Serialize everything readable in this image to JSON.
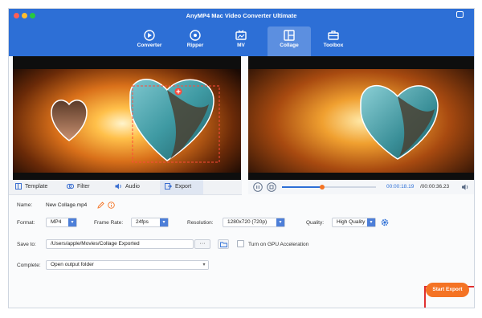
{
  "app": {
    "title": "AnyMP4 Mac Video Converter Ultimate"
  },
  "nav": [
    {
      "label": "Converter",
      "icon": "converter-icon"
    },
    {
      "label": "Ripper",
      "icon": "ripper-icon"
    },
    {
      "label": "MV",
      "icon": "mv-icon"
    },
    {
      "label": "Collage",
      "icon": "collage-icon",
      "active": true
    },
    {
      "label": "Toolbox",
      "icon": "toolbox-icon"
    }
  ],
  "tabs": [
    {
      "label": "Template",
      "icon": "template-icon"
    },
    {
      "label": "Filter",
      "icon": "filter-icon"
    },
    {
      "label": "Audio",
      "icon": "audio-icon"
    },
    {
      "label": "Export",
      "icon": "export-icon",
      "active": true
    }
  ],
  "player": {
    "current_time": "00:00:18.19",
    "total_time": "/00:00:36.23",
    "progress": 0.43
  },
  "export": {
    "name_label": "Name:",
    "name_value": "New Collage.mp4",
    "format_label": "Format:",
    "format_value": "MP4",
    "frame_rate_label": "Frame Rate:",
    "frame_rate_value": "24fps",
    "resolution_label": "Resolution:",
    "resolution_value": "1280x720 (720p)",
    "quality_label": "Quality:",
    "quality_value": "High Quality",
    "save_to_label": "Save to:",
    "save_to_value": "/Users/apple/Movies/Collage Exported",
    "browse_label": "···",
    "gpu_label": "Turn on GPU Acceleration",
    "complete_label": "Complete:",
    "complete_value": "Open output folder",
    "start_label": "Start Export"
  },
  "colors": {
    "brand": "#2d6fd6",
    "accent": "#f47324",
    "highlight": "#e03030"
  }
}
